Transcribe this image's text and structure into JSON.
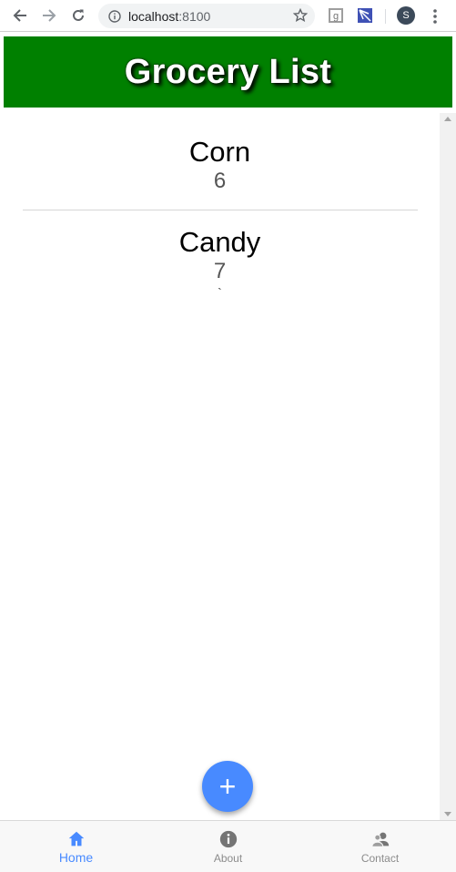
{
  "browser": {
    "url_host": "localhost",
    "url_port": ":8100",
    "profile_initial": "S"
  },
  "header": {
    "title": "Grocery List"
  },
  "items": [
    {
      "name": "Corn",
      "quantity": "6"
    },
    {
      "name": "Candy",
      "quantity": "7"
    }
  ],
  "stray_mark": "`",
  "fab": {
    "label": "+"
  },
  "tabs": [
    {
      "label": "Home",
      "icon": "home-icon",
      "active": true
    },
    {
      "label": "About",
      "icon": "info-icon",
      "active": false
    },
    {
      "label": "Contact",
      "icon": "contacts-icon",
      "active": false
    }
  ],
  "colors": {
    "header_bg": "#008000",
    "accent": "#488aff",
    "tab_inactive": "#8c8c8c"
  }
}
